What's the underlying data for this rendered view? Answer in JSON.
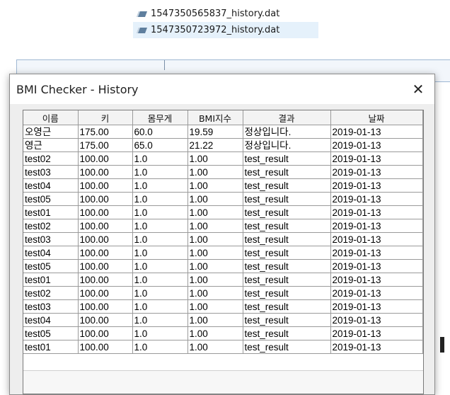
{
  "files": [
    {
      "name": "1547350565837_history.dat",
      "selected": false
    },
    {
      "name": "1547350723972_history.dat",
      "selected": true
    }
  ],
  "dialog": {
    "title": "BMI Checker - History",
    "close_glyph": "✕",
    "columns": [
      "이름",
      "키",
      "몸무게",
      "BMI지수",
      "결과",
      "날짜"
    ],
    "rows": [
      [
        "오영근",
        "175.00",
        "60.0",
        "19.59",
        "정상입니다.",
        "2019-01-13"
      ],
      [
        "영근",
        "175.00",
        "65.0",
        "21.22",
        "정상입니다.",
        "2019-01-13"
      ],
      [
        "test02",
        "100.00",
        "1.0",
        "1.00",
        "test_result",
        "2019-01-13"
      ],
      [
        "test03",
        "100.00",
        "1.0",
        "1.00",
        "test_result",
        "2019-01-13"
      ],
      [
        "test04",
        "100.00",
        "1.0",
        "1.00",
        "test_result",
        "2019-01-13"
      ],
      [
        "test05",
        "100.00",
        "1.0",
        "1.00",
        "test_result",
        "2019-01-13"
      ],
      [
        "test01",
        "100.00",
        "1.0",
        "1.00",
        "test_result",
        "2019-01-13"
      ],
      [
        "test02",
        "100.00",
        "1.0",
        "1.00",
        "test_result",
        "2019-01-13"
      ],
      [
        "test03",
        "100.00",
        "1.0",
        "1.00",
        "test_result",
        "2019-01-13"
      ],
      [
        "test04",
        "100.00",
        "1.0",
        "1.00",
        "test_result",
        "2019-01-13"
      ],
      [
        "test05",
        "100.00",
        "1.0",
        "1.00",
        "test_result",
        "2019-01-13"
      ],
      [
        "test01",
        "100.00",
        "1.0",
        "1.00",
        "test_result",
        "2019-01-13"
      ],
      [
        "test02",
        "100.00",
        "1.0",
        "1.00",
        "test_result",
        "2019-01-13"
      ],
      [
        "test03",
        "100.00",
        "1.0",
        "1.00",
        "test_result",
        "2019-01-13"
      ],
      [
        "test04",
        "100.00",
        "1.0",
        "1.00",
        "test_result",
        "2019-01-13"
      ],
      [
        "test05",
        "100.00",
        "1.0",
        "1.00",
        "test_result",
        "2019-01-13"
      ],
      [
        "test01",
        "100.00",
        "1.0",
        "1.00",
        "test_result",
        "2019-01-13"
      ]
    ]
  },
  "icons": {
    "file": "dat-file-icon",
    "close": "close-icon"
  },
  "colors": {
    "selection": "#e5f1fb",
    "grid": "#9a9a9a",
    "header_bg": "#f3f3f3"
  }
}
